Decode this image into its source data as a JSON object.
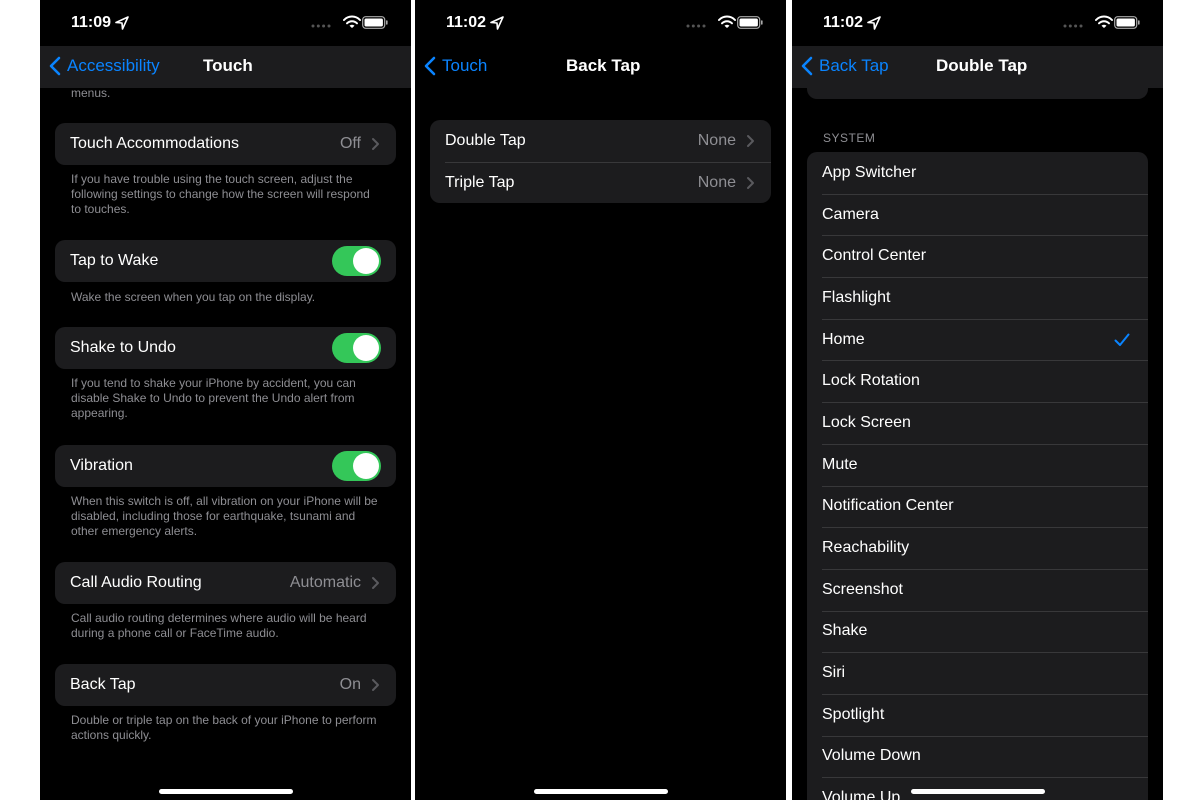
{
  "colors": {
    "accent": "#0a84ff",
    "toggle_on": "#34c759",
    "cell_background": "#1c1c1e",
    "secondary_text": "#8e8e93"
  },
  "touch_screen": {
    "status": {
      "time": "11:09"
    },
    "nav": {
      "back_label": "Accessibility",
      "title": "Touch"
    },
    "top_footer_fragment": "menus.",
    "touch_accommodations": {
      "label": "Touch Accommodations",
      "value": "Off",
      "footer": "If you have trouble using the touch screen, adjust the following settings to change how the screen will respond to touches."
    },
    "tap_to_wake": {
      "label": "Tap to Wake",
      "on": true,
      "footer": "Wake the screen when you tap on the display."
    },
    "shake_to_undo": {
      "label": "Shake to Undo",
      "on": true,
      "footer": "If you tend to shake your iPhone by accident, you can disable Shake to Undo to prevent the Undo alert from appearing."
    },
    "vibration": {
      "label": "Vibration",
      "on": true,
      "footer": "When this switch is off, all vibration on your iPhone will be disabled, including those for earthquake, tsunami and other emergency alerts."
    },
    "call_audio_routing": {
      "label": "Call Audio Routing",
      "value": "Automatic",
      "footer": "Call audio routing determines where audio will be heard during a phone call or FaceTime audio."
    },
    "back_tap": {
      "label": "Back Tap",
      "value": "On",
      "footer": "Double or triple tap on the back of your iPhone to perform actions quickly."
    }
  },
  "back_tap_screen": {
    "status": {
      "time": "11:02"
    },
    "nav": {
      "back_label": "Touch",
      "title": "Back Tap"
    },
    "rows": [
      {
        "label": "Double Tap",
        "value": "None"
      },
      {
        "label": "Triple Tap",
        "value": "None"
      }
    ]
  },
  "double_tap_screen": {
    "status": {
      "time": "11:02"
    },
    "nav": {
      "back_label": "Back Tap",
      "title": "Double Tap"
    },
    "section_header": "SYSTEM",
    "options": [
      {
        "label": "App Switcher",
        "selected": false
      },
      {
        "label": "Camera",
        "selected": false
      },
      {
        "label": "Control Center",
        "selected": false
      },
      {
        "label": "Flashlight",
        "selected": false
      },
      {
        "label": "Home",
        "selected": true
      },
      {
        "label": "Lock Rotation",
        "selected": false
      },
      {
        "label": "Lock Screen",
        "selected": false
      },
      {
        "label": "Mute",
        "selected": false
      },
      {
        "label": "Notification Center",
        "selected": false
      },
      {
        "label": "Reachability",
        "selected": false
      },
      {
        "label": "Screenshot",
        "selected": false
      },
      {
        "label": "Shake",
        "selected": false
      },
      {
        "label": "Siri",
        "selected": false
      },
      {
        "label": "Spotlight",
        "selected": false
      },
      {
        "label": "Volume Down",
        "selected": false
      },
      {
        "label": "Volume Up",
        "selected": false
      }
    ]
  }
}
